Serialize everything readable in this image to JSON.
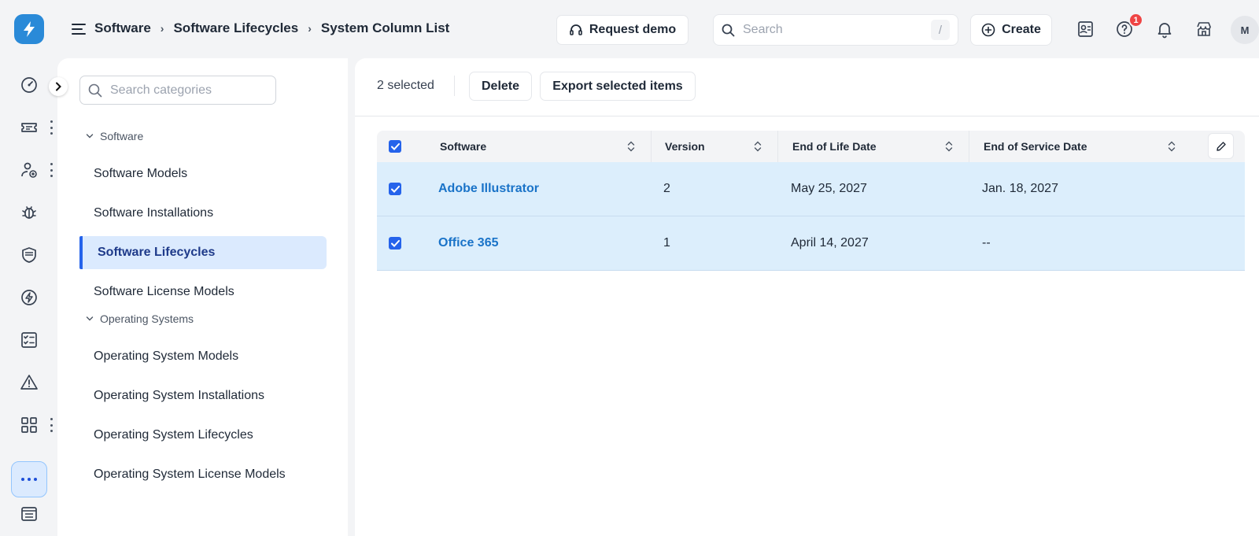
{
  "breadcrumb": [
    "Software",
    "Software Lifecycles",
    "System Column List"
  ],
  "header": {
    "request_demo_label": "Request demo",
    "search_placeholder": "Search",
    "search_shortcut": "/",
    "create_label": "Create",
    "help_badge_count": "1",
    "avatar_initial": "M"
  },
  "categories": {
    "search_placeholder": "Search categories",
    "groups": [
      {
        "label": "Software",
        "items": [
          "Software Models",
          "Software Installations",
          "Software Lifecycles",
          "Software License Models"
        ]
      },
      {
        "label": "Operating Systems",
        "items": [
          "Operating System Models",
          "Operating System Installations",
          "Operating System Lifecycles",
          "Operating System License Models"
        ]
      }
    ],
    "active_item": "Software Lifecycles"
  },
  "bulk_actions": {
    "selected_text": "2 selected",
    "delete_label": "Delete",
    "export_label": "Export selected items"
  },
  "table": {
    "columns": [
      "Software",
      "Version",
      "End of Life Date",
      "End of Service Date"
    ],
    "rows": [
      {
        "software": "Adobe Illustrator",
        "version": "2",
        "end_of_life": "May 25, 2027",
        "end_of_service": "Jan. 18, 2027",
        "selected": true
      },
      {
        "software": "Office 365",
        "version": "1",
        "end_of_life": "April 14, 2027",
        "end_of_service": "--",
        "selected": true
      }
    ]
  },
  "colors": {
    "accent": "#2563eb",
    "link": "#1a73c8",
    "selected_row": "#dceefc",
    "logo": "#2a8ad8",
    "badge": "#ef4444"
  }
}
